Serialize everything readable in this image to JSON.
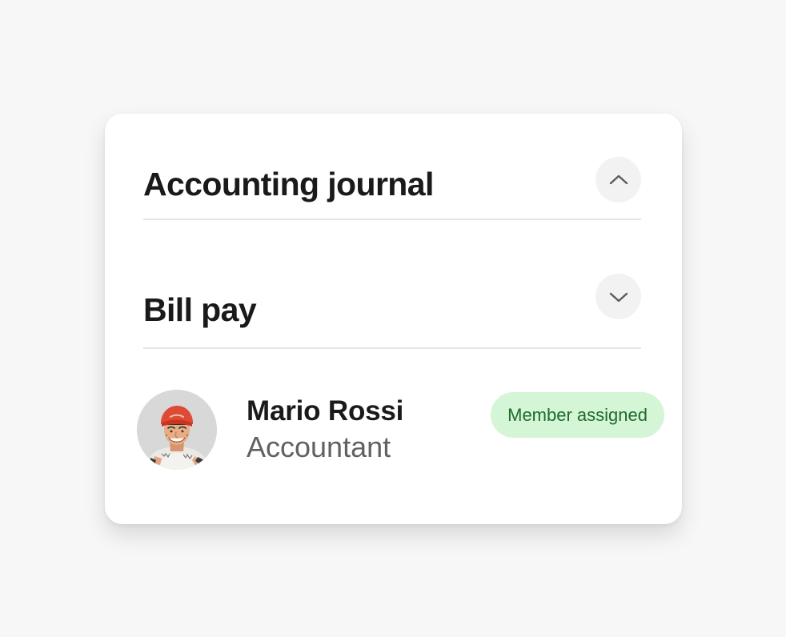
{
  "sections": [
    {
      "title": "Accounting journal",
      "state": "expanded",
      "toggle_icon": "chevron-up-icon"
    },
    {
      "title": "Bill pay",
      "state": "collapsed",
      "toggle_icon": "chevron-down-icon"
    }
  ],
  "member": {
    "name": "Mario Rossi",
    "role": "Accountant",
    "status": "Member assigned",
    "status_color": "#1f6b2b",
    "status_background": "#d4f5d6"
  }
}
